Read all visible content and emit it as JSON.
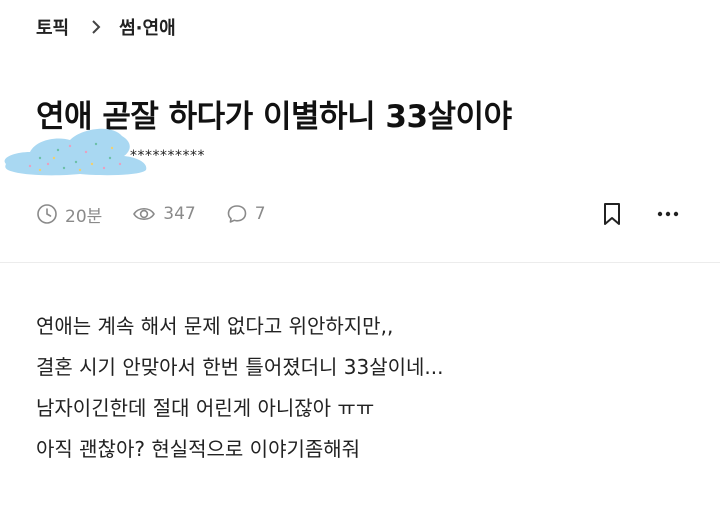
{
  "breadcrumb": {
    "parent": "토픽",
    "current": "썸·연애"
  },
  "post": {
    "title": "연애 곧잘 하다가 이별하니 33살이야",
    "author_masked": "**********",
    "elapsed": "20분",
    "views": "347",
    "comments": "7",
    "body_lines": [
      "연애는 계속 해서 문제 없다고 위안하지만,,",
      "결혼 시기 안맞아서 한번 틀어졌더니 33살이네...",
      "남자이긴한데 절대 어린게 아니잖아 ㅠㅠ",
      "아직 괜찮아? 현실적으로 이야기좀해줘"
    ]
  },
  "icons": {
    "chevron": "chevron-right-icon",
    "clock": "clock-icon",
    "eye": "eye-icon",
    "comment": "comment-icon",
    "bookmark": "bookmark-icon",
    "more": "more-horizontal-icon"
  },
  "colors": {
    "meta_gray": "#8a8a8a",
    "blob": "#a9d8f2"
  }
}
